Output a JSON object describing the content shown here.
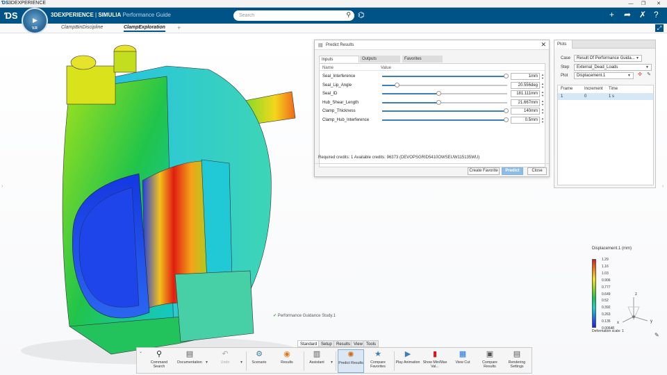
{
  "window": {
    "title": "3DEXPERIENCE",
    "controls": [
      "—",
      "❐",
      "✕"
    ]
  },
  "appbar": {
    "brand_strong": "3DEXPERIENCE",
    "brand_sep": " | ",
    "brand_company": "SIMULIA",
    "brand_app": " Performance Guide",
    "search_placeholder": "Search",
    "compass_version": "V.R"
  },
  "tabs": {
    "items": [
      "ClampBinDiscipline",
      "ClampExploration"
    ],
    "active": "ClampExploration",
    "add": "+"
  },
  "dialog": {
    "title": "Predict Results",
    "tabs": [
      "Inputs",
      "Outputs",
      "Favorites"
    ],
    "active_tab": "Inputs",
    "col_name": "Name",
    "col_value": "Value",
    "params": [
      {
        "name": "Seal_Interference",
        "value": "1mm",
        "level": 0.99
      },
      {
        "name": "Seal_Lip_Angle",
        "value": "20.556deg",
        "level": 0.12
      },
      {
        "name": "Seal_ID",
        "value": "181.111mm",
        "level": 0.45
      },
      {
        "name": "Hub_Shear_Length",
        "value": "21.667mm",
        "level": 0.45
      },
      {
        "name": "Clamp_Thickness",
        "value": "140mm",
        "level": 0.99
      },
      {
        "name": "Clamp_Hub_Interference",
        "value": "0.5mm",
        "level": 0.99
      }
    ],
    "credits": "Required credits: 1   Available credits: 96373 (DEVOPSGRID5410OWSEUW115135WU)",
    "btn_favorite": "Create Favorite",
    "btn_predict": "Predict",
    "btn_close": "Close"
  },
  "plots": {
    "tab": "Plots",
    "case_label": "Case",
    "case_value": "Result Of Performance Guida...",
    "step_label": "Step",
    "step_value": "External_Dead_Loads",
    "plot_label": "Plot",
    "plot_value": "Displacement.1",
    "col_frame": "Frame",
    "col_increment": "Increment",
    "col_time": "Time",
    "row": {
      "frame": "1",
      "increment": "0",
      "time": "1 s"
    }
  },
  "legend": {
    "title": "Displacement.1 (mm)",
    "ticks": [
      "1.29",
      "1.16",
      "1.03",
      "0.906",
      "0.777",
      "0.649",
      "0.52",
      "0.392",
      "0.263",
      "0.135",
      "0.00648"
    ],
    "scale": "Deformation scale: 1"
  },
  "triad": {
    "x": "x",
    "y": "y",
    "z": "z"
  },
  "study": "Performance Guidance Study.1",
  "toolbar": {
    "tabs": [
      "Standard",
      "Setup",
      "Results",
      "View",
      "Tools"
    ],
    "active_tab": "Standard",
    "buttons": [
      {
        "label": "Command Search",
        "icon": "search-icon"
      },
      {
        "label": "Documentation",
        "icon": "book-icon"
      },
      {
        "label": "Undo",
        "icon": "undo-icon"
      },
      {
        "label": "Scenario",
        "icon": "scenario-icon"
      },
      {
        "label": "Results",
        "icon": "results-icon"
      },
      {
        "label": "Assistant",
        "icon": "assistant-icon"
      },
      {
        "label": "Predict Results",
        "icon": "predict-icon"
      },
      {
        "label": "Compare Favorites",
        "icon": "star-icon"
      },
      {
        "label": "Play Animation",
        "icon": "play-animation-icon"
      },
      {
        "label": "Show Min/Max Val...",
        "icon": "minmax-icon"
      },
      {
        "label": "View Cut",
        "icon": "view-cut-icon"
      },
      {
        "label": "Compare Results",
        "icon": "compare-icon"
      },
      {
        "label": "Rendering Settings",
        "icon": "rendering-icon"
      }
    ]
  },
  "colors": {
    "brand": "#005386",
    "accent": "#3a7fb6"
  }
}
